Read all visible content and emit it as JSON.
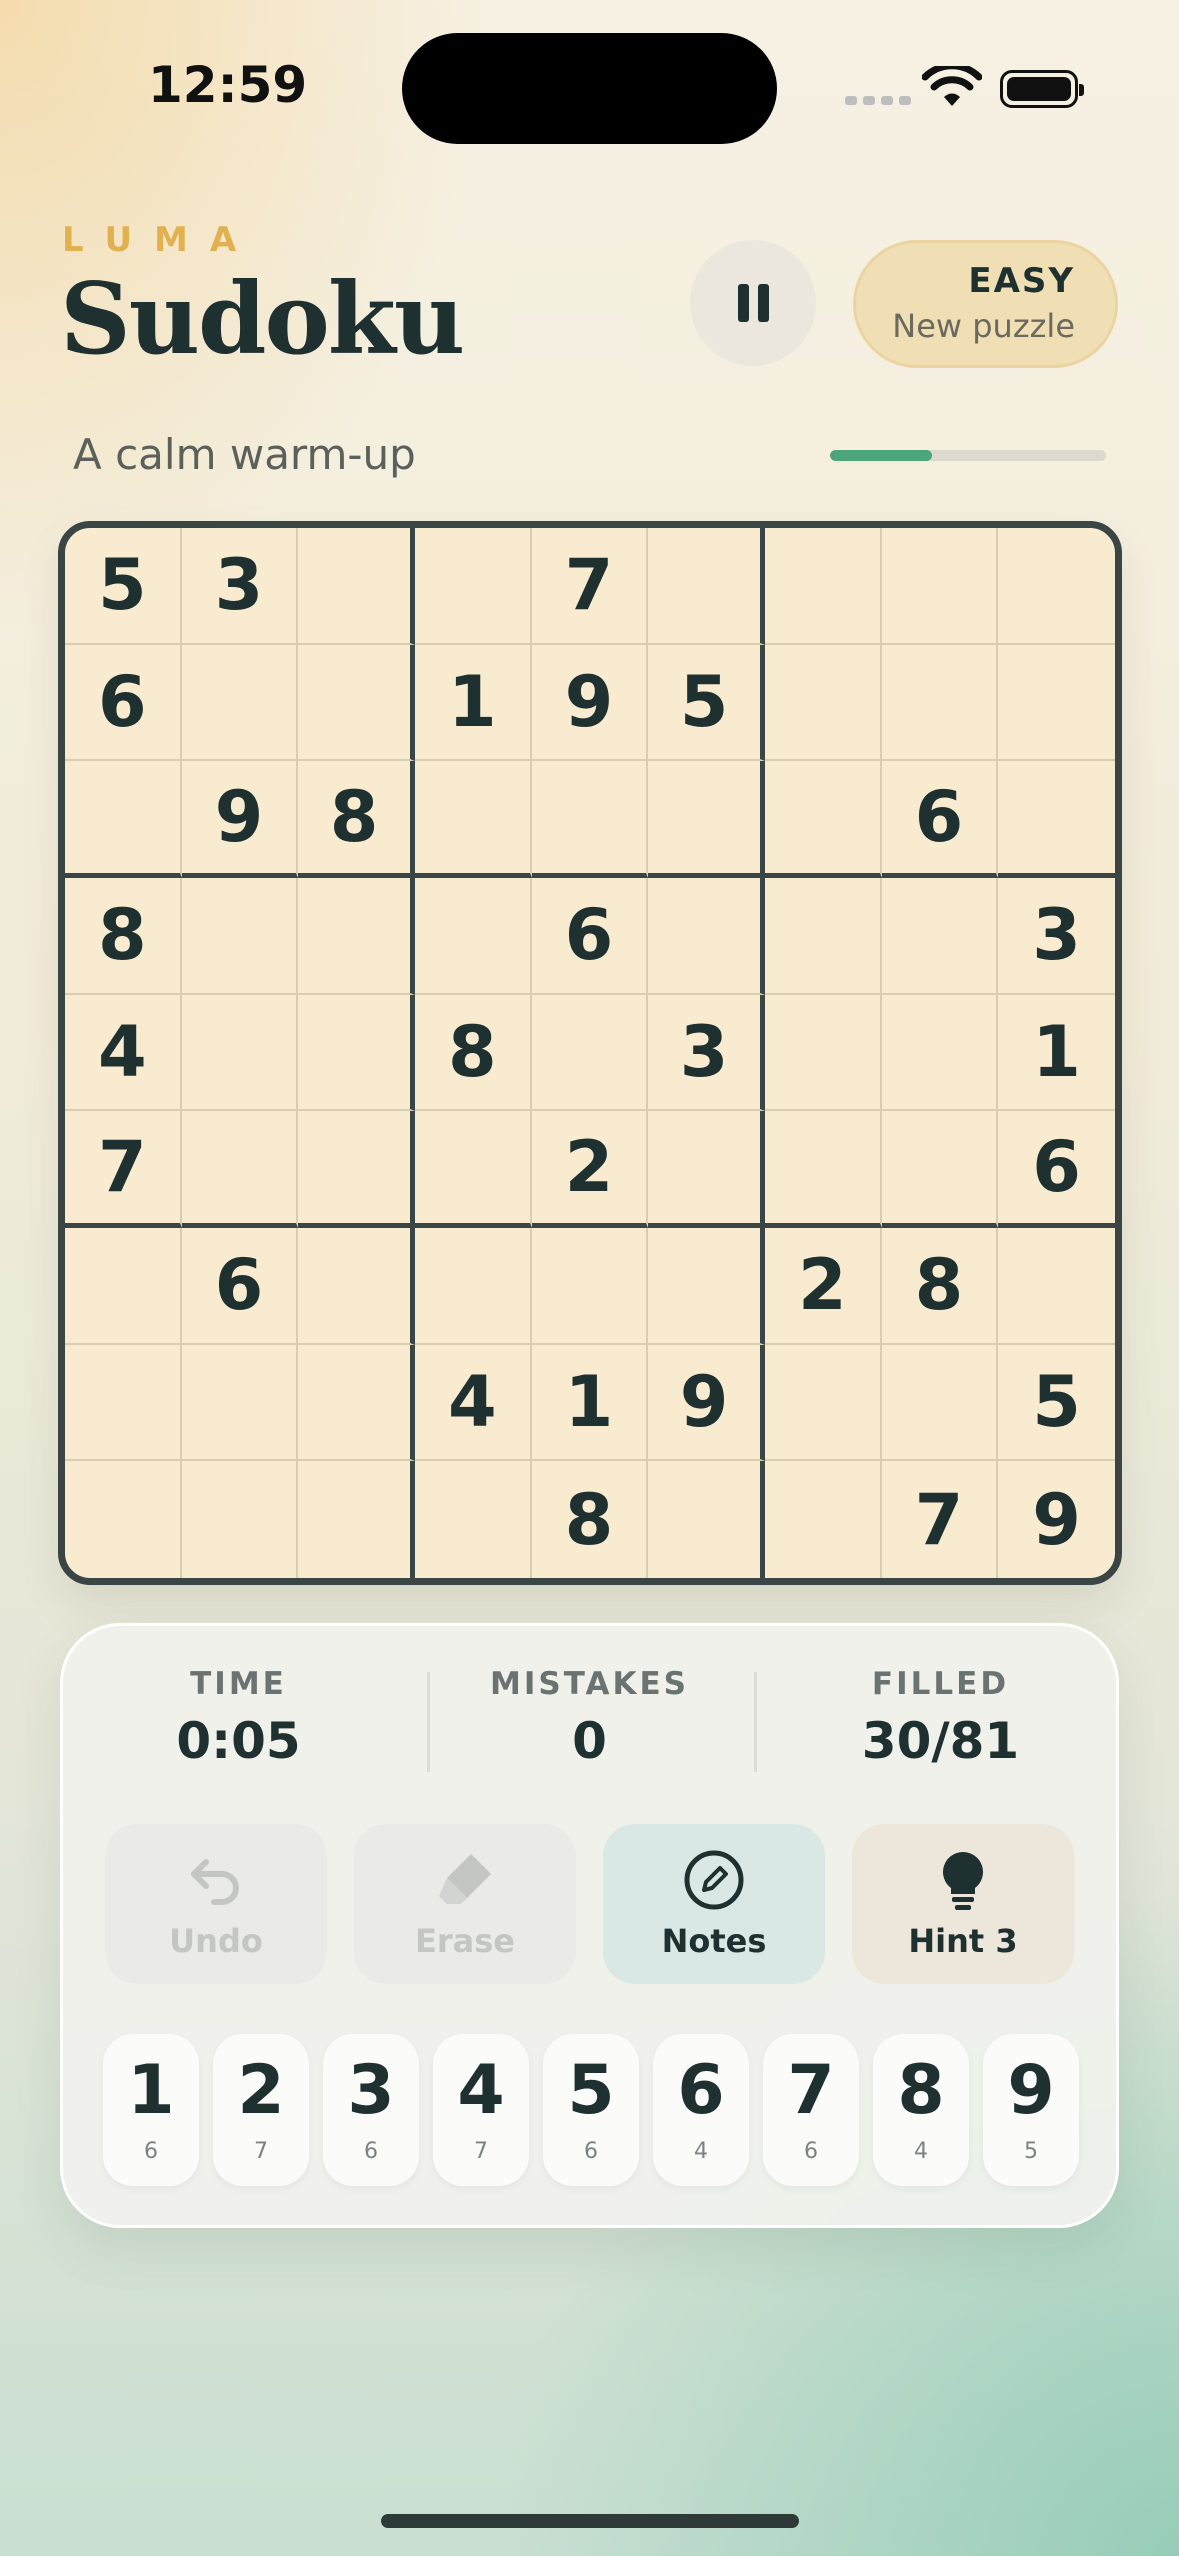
{
  "status_bar": {
    "time": "12:59"
  },
  "header": {
    "brand": "LUMA",
    "title": "Sudoku",
    "difficulty": {
      "level": "EASY",
      "action": "New puzzle"
    },
    "subtitle": "A calm warm-up",
    "progress": 0.37
  },
  "board": {
    "rows": [
      [
        "5",
        "3",
        "",
        "",
        "7",
        "",
        "",
        "",
        ""
      ],
      [
        "6",
        "",
        "",
        "1",
        "9",
        "5",
        "",
        "",
        ""
      ],
      [
        "",
        "9",
        "8",
        "",
        "",
        "",
        "",
        "6",
        ""
      ],
      [
        "8",
        "",
        "",
        "",
        "6",
        "",
        "",
        "",
        "3"
      ],
      [
        "4",
        "",
        "",
        "8",
        "",
        "3",
        "",
        "",
        "1"
      ],
      [
        "7",
        "",
        "",
        "",
        "2",
        "",
        "",
        "",
        "6"
      ],
      [
        "",
        "6",
        "",
        "",
        "",
        "",
        "2",
        "8",
        ""
      ],
      [
        "",
        "",
        "",
        "4",
        "1",
        "9",
        "",
        "",
        "5"
      ],
      [
        "",
        "",
        "",
        "",
        "8",
        "",
        "",
        "7",
        "9"
      ]
    ]
  },
  "stats": {
    "time_label": "TIME",
    "time_value": "0:05",
    "mistakes_label": "MISTAKES",
    "mistakes_value": "0",
    "filled_label": "FILLED",
    "filled_value": "30/81"
  },
  "actions": {
    "undo": "Undo",
    "erase": "Erase",
    "notes": "Notes",
    "hint": "Hint 3"
  },
  "numpad": [
    {
      "digit": "1",
      "count": "6"
    },
    {
      "digit": "2",
      "count": "7"
    },
    {
      "digit": "3",
      "count": "6"
    },
    {
      "digit": "4",
      "count": "7"
    },
    {
      "digit": "5",
      "count": "6"
    },
    {
      "digit": "6",
      "count": "4"
    },
    {
      "digit": "7",
      "count": "6"
    },
    {
      "digit": "8",
      "count": "4"
    },
    {
      "digit": "9",
      "count": "5"
    }
  ],
  "colors": {
    "accent_green": "#4ca67a",
    "brand_gold": "#e2b14f",
    "ink": "#1f3031",
    "board_bg": "#f8ebd0"
  },
  "icons": [
    "pause-icon",
    "undo-icon",
    "eraser-icon",
    "pencil-icon",
    "lightbulb-icon",
    "wifi-icon",
    "battery-icon",
    "signal-icon"
  ]
}
